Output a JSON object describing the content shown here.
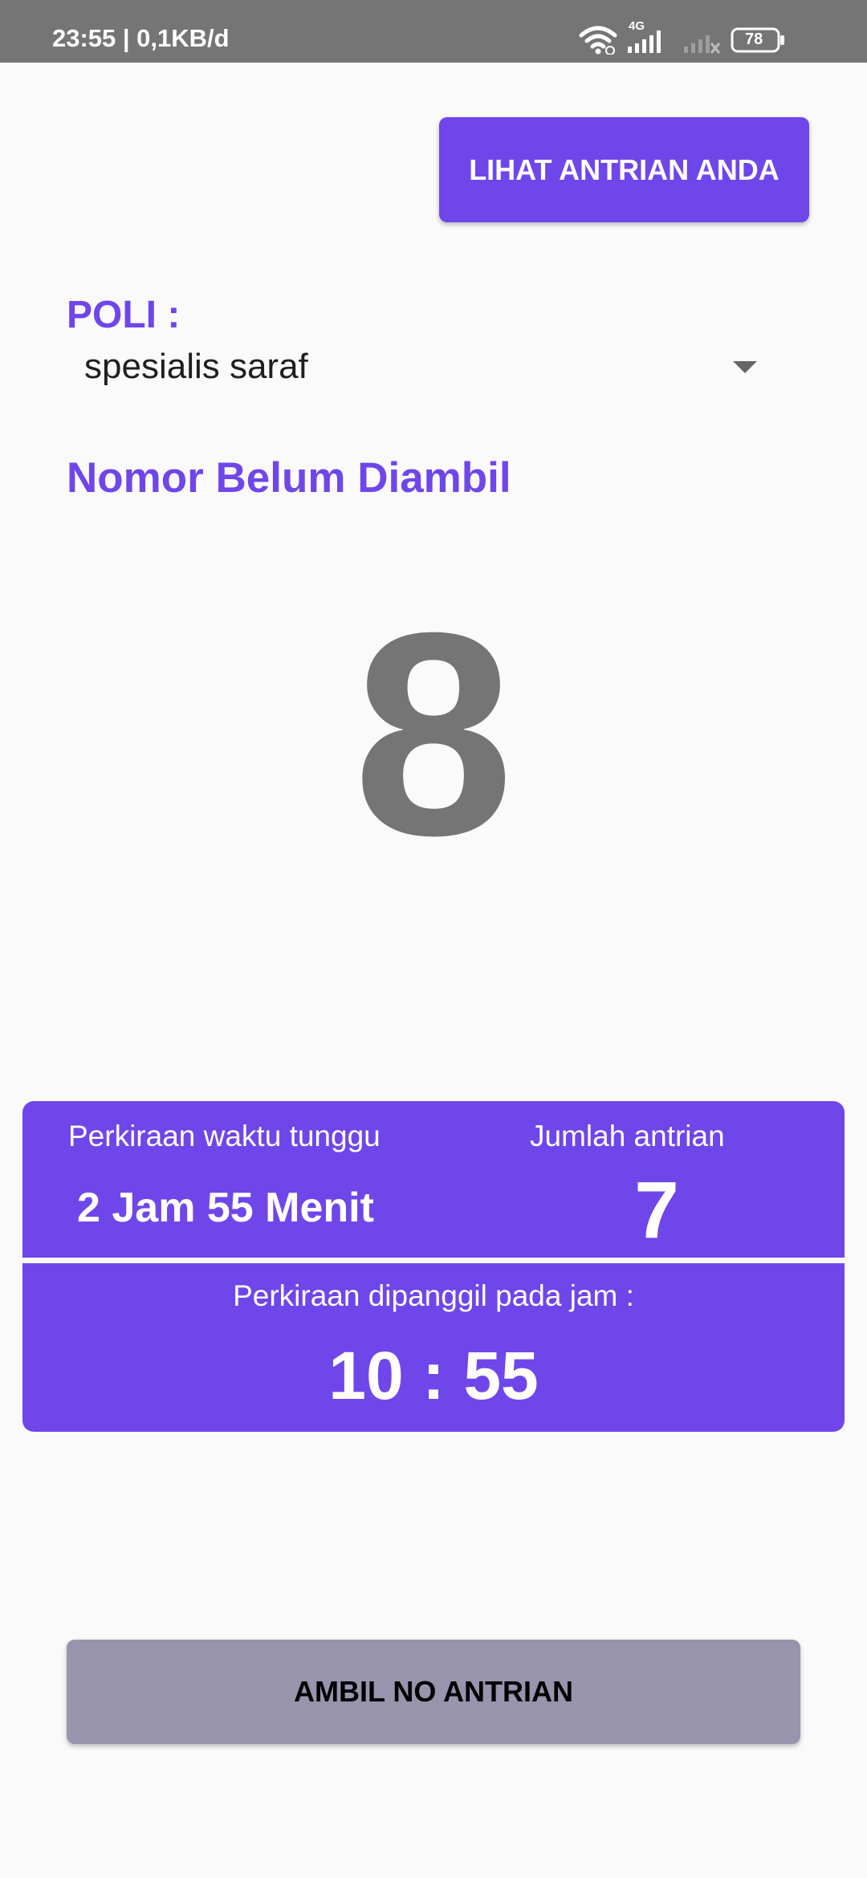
{
  "status_bar": {
    "time": "23:55 | 0,1KB/d",
    "network_type": "4G",
    "battery_level": "78",
    "icons": [
      "wifi-icon",
      "signal-icon",
      "signal-off-icon",
      "battery-icon"
    ]
  },
  "header": {
    "view_queue_button": "LIHAT ANTRIAN ANDA"
  },
  "poli": {
    "label": "POLI :",
    "selected": "spesialis saraf"
  },
  "queue": {
    "status_title": "Nomor Belum Diambil",
    "current_number": "8"
  },
  "info_panel": {
    "wait_label": "Perkiraan waktu tunggu",
    "wait_value": "2 Jam 55 Menit",
    "count_label": "Jumlah antrian",
    "count_value": "7",
    "called_label": "Perkiraan dipanggil pada jam :",
    "called_value": "10 : 55"
  },
  "footer": {
    "take_number_button": "AMBIL NO ANTRIAN"
  },
  "colors": {
    "accent": "#6f46ea",
    "status_bar": "#757575",
    "number_gray": "#757575",
    "disabled_button": "#9894ad"
  }
}
